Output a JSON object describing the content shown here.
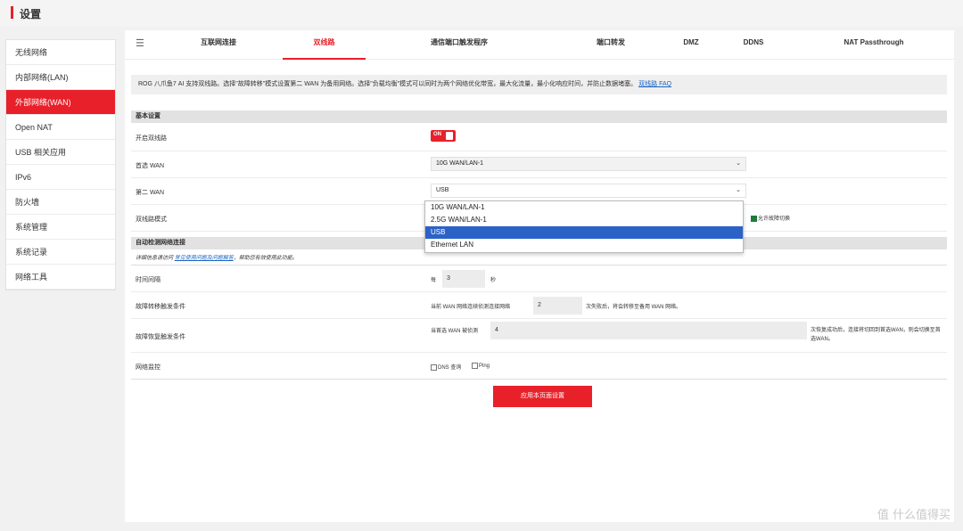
{
  "header": {
    "title": "设置"
  },
  "sidebar": {
    "items": [
      {
        "label": "无线网络"
      },
      {
        "label": "内部网络(LAN)"
      },
      {
        "label": "外部网络(WAN)"
      },
      {
        "label": "Open NAT"
      },
      {
        "label": "USB 相关应用"
      },
      {
        "label": "IPv6"
      },
      {
        "label": "防火墙"
      },
      {
        "label": "系统管理"
      },
      {
        "label": "系统记录"
      },
      {
        "label": "网络工具"
      }
    ],
    "active_index": 2
  },
  "tabs": [
    {
      "label": "互联网连接"
    },
    {
      "label": "双线路"
    },
    {
      "label": "通信端口触发程序"
    },
    {
      "label": "端口转发"
    },
    {
      "label": "DMZ"
    },
    {
      "label": "DDNS"
    },
    {
      "label": "NAT Passthrough"
    }
  ],
  "notice": {
    "text": "ROG 八爪鱼7 AI 支持双线路。选择\"故障转移\"模式设置第二 WAN 为备用网络。选择\"负载均衡\"模式可以同时为两个网络优化带宽，最大化流量，最小化响应时间，并防止数据堵塞。",
    "link": "双线路 FAQ"
  },
  "basic": {
    "section_title": "基本设置",
    "dual_wan_label": "开启双线路",
    "toggle_text": "ON",
    "primary_label": "首选 WAN",
    "primary_value": "10G WAN/LAN-1",
    "secondary_label": "第二 WAN",
    "secondary_value": "USB",
    "mode_label": "双线路模式",
    "failback_label": "允许故障切换",
    "dropdown_options": [
      "10G WAN/LAN-1",
      "2.5G WAN/LAN-1",
      "USB",
      "Ethernet LAN"
    ]
  },
  "detect": {
    "section_title": "自动检测网络连接",
    "desc_prefix": "详细信息请访问",
    "desc_link": "常见使用问题及问题解答",
    "desc_suffix": "，帮助您有效使用此功能。",
    "interval_label": "时间间隔",
    "interval_prefix": "每",
    "interval_value": "3",
    "interval_unit": "秒",
    "failover_label": "故障转移触发条件",
    "failover_text1": "当前 WAN 网络连续侦测连接网络",
    "failover_value": "2",
    "failover_text2": "次失败后，将会转移至备用 WAN 网络。",
    "failback_trigger_label": "故障恢复触发条件",
    "failback_text1": "当首选 WAN 被侦测",
    "failback_value": "4",
    "failback_text2": "次恢复成功后，连接将切回到首选WAN，则会切换至首选WAN。",
    "monitor_label": "网络监控",
    "dns_label": "DNS 查询",
    "ping_label": "Ping"
  },
  "apply_label": "应用本页面设置",
  "watermark": "值 什么值得买",
  "colors": {
    "accent": "#e8202a",
    "selection": "#2b62c8"
  }
}
